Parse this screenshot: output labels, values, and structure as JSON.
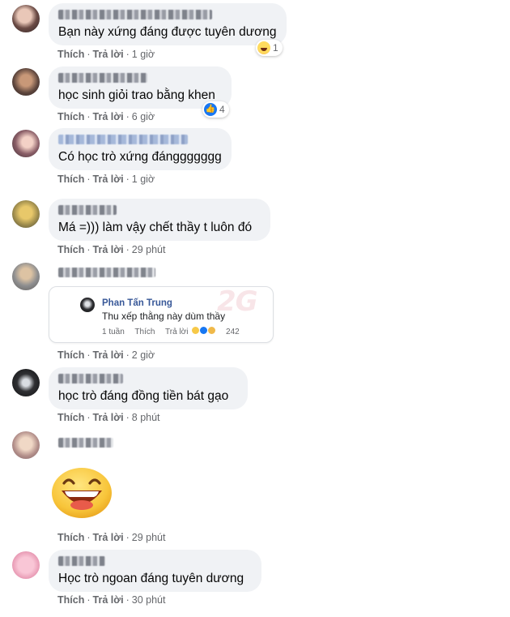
{
  "actions": {
    "like": "Thích",
    "reply": "Trả lời",
    "dot": "·"
  },
  "comments": [
    {
      "text": "Bạn này xứng đáng được tuyên dương",
      "time": "1 giờ",
      "reaction": {
        "icon": "haha-icon",
        "count": "1"
      }
    },
    {
      "text": "học sinh giỏi trao bằng khen",
      "time": "6 giờ",
      "reaction": {
        "icon": "like-icon",
        "count": "4"
      }
    },
    {
      "text": "Có học trò xứng đánggggggg",
      "time": "1 giờ"
    },
    {
      "text": "Má =))) làm vậy chết thầy t luôn đó",
      "time": "29 phút"
    },
    {
      "time": "2 giờ",
      "quoted": {
        "name": "Phan Tấn Trung",
        "text": "Thu xếp thằng này dùm thầy",
        "age": "1 tuần",
        "like": "Thích",
        "reply": "Trả lời",
        "reaction_count": "242"
      }
    },
    {
      "text": "học trò đáng đồng tiền bát gạo",
      "time": "8 phút"
    },
    {
      "sticker": "laughing-face-sticker",
      "time": "29 phút"
    },
    {
      "text": "Học trò ngoan đáng tuyên dương",
      "time": "30 phút"
    }
  ],
  "watermark": "2G",
  "colors": {
    "bubble": "#f0f2f5",
    "meta": "#65676b",
    "like_blue": "#1877f2",
    "link_name": "#385898"
  }
}
